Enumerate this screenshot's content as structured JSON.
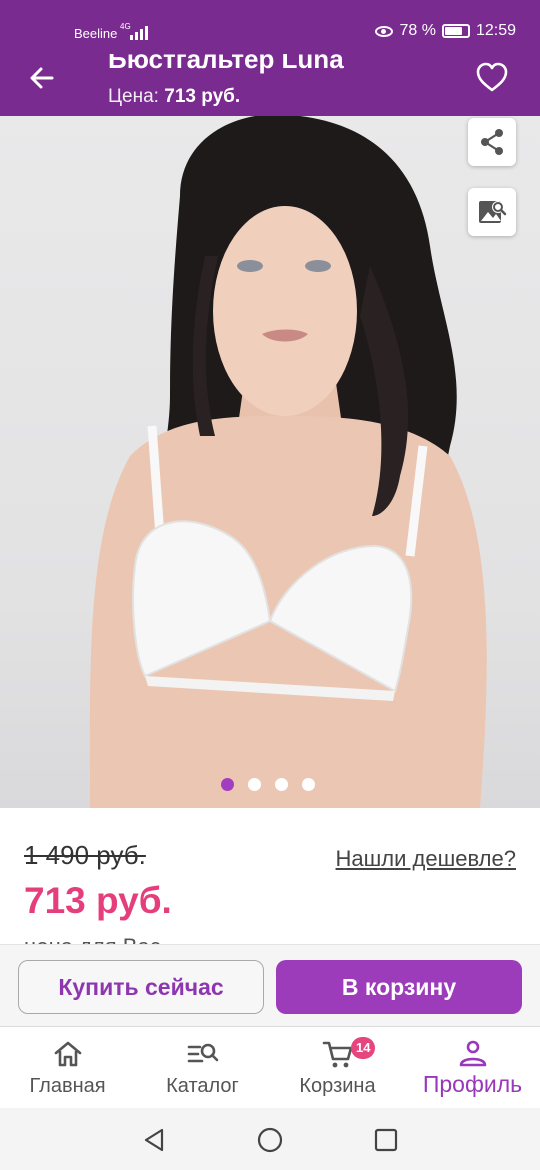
{
  "status_bar": {
    "carrier": "Beeline",
    "network": "4G",
    "battery": "78 %",
    "battery_level": 0.78,
    "time": "12:59"
  },
  "header": {
    "title": "Бюстгальтер Luna",
    "price_label": "Цена:",
    "price_value": "713 руб."
  },
  "gallery": {
    "slide_count": 4,
    "active_index": 0
  },
  "pricing": {
    "old_price": "1 490 руб.",
    "cheaper_link": "Нашли дешевле?",
    "new_price": "713 руб.",
    "for_you": "цена для Вас"
  },
  "actions": {
    "buy_now": "Купить сейчас",
    "add_to_cart": "В корзину"
  },
  "bottom_nav": {
    "items": [
      {
        "label": "Главная",
        "icon": "home-icon"
      },
      {
        "label": "Каталог",
        "icon": "catalog-search-icon"
      },
      {
        "label": "Корзина",
        "icon": "cart-icon",
        "badge": "14"
      },
      {
        "label": "Профиль",
        "icon": "profile-icon",
        "active": true
      }
    ]
  },
  "colors": {
    "primary": "#7a2b8f",
    "accent": "#9c3cba",
    "price": "#e43f7c",
    "badge": "#e6467e"
  }
}
